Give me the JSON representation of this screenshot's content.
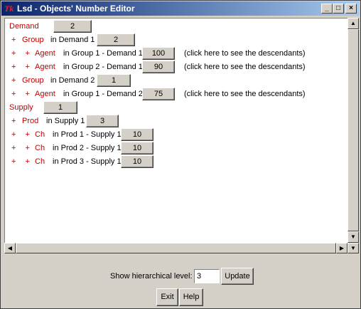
{
  "window": {
    "icon": "Tk",
    "title": "Lsd - Objects' Number Editor",
    "controls": [
      "_",
      "□",
      "×"
    ]
  },
  "rows": [
    {
      "name": "row-demand",
      "prefix": "",
      "object": "Demand",
      "context": "",
      "value": "2",
      "note": ""
    },
    {
      "name": "row-group-demand1",
      "prefix": "+",
      "object": "Group",
      "context": "in Demand 1",
      "value": "2",
      "note": ""
    },
    {
      "name": "row-agent-group1-demand1",
      "prefix": "+ +",
      "object": "Agent",
      "context": "in Group 1 - Demand 1",
      "value": "100",
      "note": "(click here to see the descendants)"
    },
    {
      "name": "row-agent-group2-demand1",
      "prefix": "+ +",
      "object": "Agent",
      "context": "in Group 2 - Demand 1",
      "value": "90",
      "note": "(click here to see the descendants)"
    },
    {
      "name": "row-group-demand2",
      "prefix": "+",
      "object": "Group",
      "context": "in Demand 2",
      "value": "1",
      "note": ""
    },
    {
      "name": "row-agent-group1-demand2",
      "prefix": "+ +",
      "object": "Agent",
      "context": "in Group 1 - Demand 2",
      "value": "75",
      "note": "(click here to see the descendants)"
    },
    {
      "name": "row-supply",
      "prefix": "",
      "object": "Supply",
      "context": "",
      "value": "1",
      "note": ""
    },
    {
      "name": "row-prod-supply1",
      "prefix": "+",
      "object": "Prod",
      "context": "in Supply 1",
      "value": "3",
      "note": ""
    },
    {
      "name": "row-ch-prod1",
      "prefix": "+ +",
      "object": "Ch",
      "context": "in Prod 1 - Supply 1",
      "value": "10",
      "note": ""
    },
    {
      "name": "row-ch-prod2",
      "prefix": "+ +",
      "object": "Ch",
      "context": "in Prod 2 - Supply 1",
      "value": "10",
      "note": ""
    },
    {
      "name": "row-ch-prod3",
      "prefix": "+ +",
      "object": "Ch",
      "context": "in Prod 3 - Supply 1",
      "value": "10",
      "note": ""
    }
  ],
  "footer": {
    "level_label": "Show hierarchical level:",
    "level_value": "3",
    "update_label": "Update",
    "exit_label": "Exit",
    "help_label": "Help"
  },
  "colors": {
    "object_text": "#c00000",
    "title_gradient_start": "#0a246a"
  }
}
